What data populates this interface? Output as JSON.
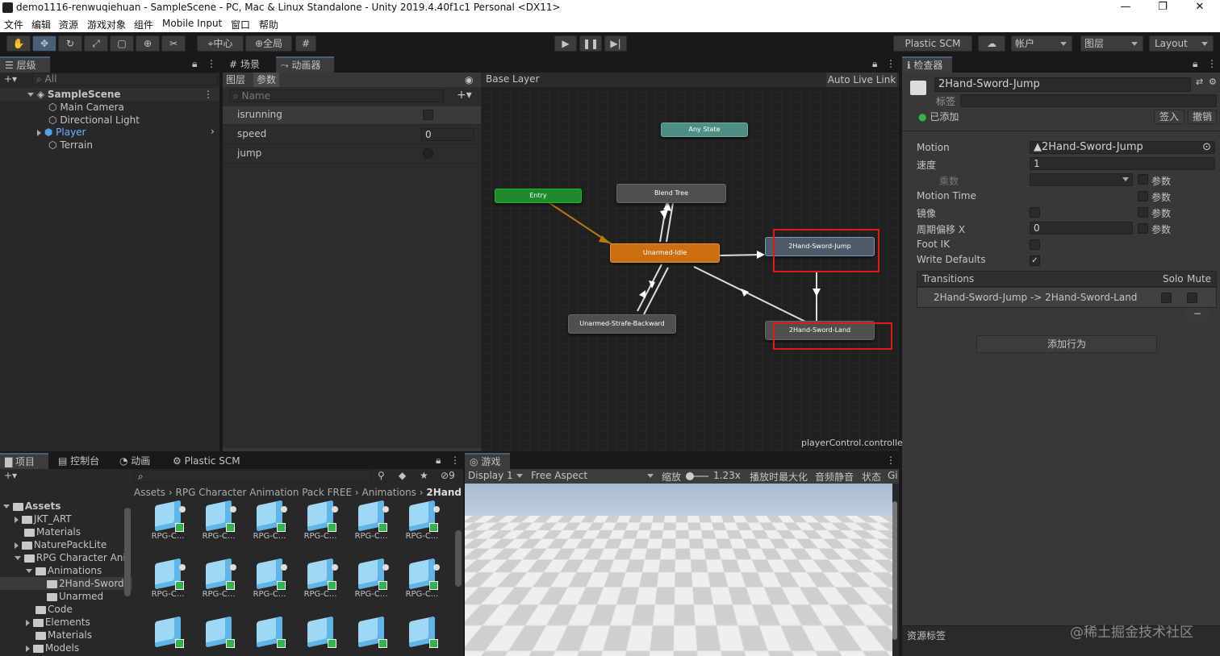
{
  "window": {
    "title": "demo1116-renwuqiehuan - SampleScene - PC, Mac & Linux Standalone - Unity 2019.4.40f1c1 Personal <DX11>",
    "min": "—",
    "max": "❐",
    "close": "✕"
  },
  "menu": [
    "文件",
    "编辑",
    "资源",
    "游戏对象",
    "组件",
    "Mobile Input",
    "窗口",
    "帮助"
  ],
  "toolbar": {
    "pivot": "中心",
    "global": "全局",
    "plastic": "Plastic SCM",
    "account": "帐户",
    "layers": "图层",
    "layout": "Layout"
  },
  "hierarchy": {
    "tab": "层级",
    "search": "All",
    "scene": "SampleScene",
    "items": [
      "Main Camera",
      "Directional Light",
      "Player",
      "Terrain"
    ]
  },
  "animator": {
    "tab_scene": "场景",
    "tab_animator": "动画器",
    "sub_layers": "图层",
    "sub_params": "参数",
    "search": "Name",
    "params": [
      {
        "name": "isrunning",
        "value": ""
      },
      {
        "name": "speed",
        "value": "0"
      },
      {
        "name": "jump",
        "value": ""
      }
    ],
    "layer": "Base Layer",
    "auto_live": "Auto Live Link",
    "controller": "playerControl.controller",
    "nodes": {
      "any": "Any State",
      "entry": "Entry",
      "blend": "Blend Tree",
      "idle": "Unarmed-Idle",
      "jump": "2Hand-Sword-Jump",
      "strafe": "Unarmed-Strafe-Backward",
      "land": "2Hand-Sword-Land"
    }
  },
  "inspector": {
    "tab": "检查器",
    "name": "2Hand-Sword-Jump",
    "tag": "标签",
    "added": "已添加",
    "btn_in": "签入",
    "btn_undo": "撤销",
    "motion_label": "Motion",
    "motion_value": "2Hand-Sword-Jump",
    "speed_label": "速度",
    "speed_value": "1",
    "mult_label": "乘数",
    "param": "参数",
    "motion_time": "Motion Time",
    "mirror": "镜像",
    "cycle_label": "周期偏移 X",
    "cycle_value": "0",
    "foot_ik": "Foot IK",
    "write_defaults": "Write Defaults",
    "transitions": "Transitions",
    "solo": "Solo",
    "mute": "Mute",
    "transition": "2Hand-Sword-Jump -> 2Hand-Sword-Land",
    "add_behaviour": "添加行为",
    "asset_labels": "资源标签",
    "check": "✓"
  },
  "project": {
    "tabs": [
      "项目",
      "控制台",
      "动画",
      "Plastic SCM"
    ],
    "count": "9",
    "breadcrumb": [
      "Assets",
      "RPG Character Animation Pack FREE",
      "Animations",
      "2Hand"
    ],
    "tree": [
      "Assets",
      "JKT_ART",
      "Materials",
      "NaturePackLite",
      "RPG Character Ani",
      "Animations",
      "2Hand-Sword",
      "Unarmed",
      "Code",
      "Elements",
      "Materials",
      "Models"
    ],
    "asset_label": "RPG-C..."
  },
  "game": {
    "tab": "游戏",
    "display": "Display 1",
    "aspect": "Free Aspect",
    "scale_label": "缩放",
    "scale_value": "1.23x",
    "maximize": "播放时最大化",
    "mute": "音频静音",
    "stats": "状态",
    "gizmos": "Gi"
  },
  "watermark": "@稀土掘金技术社区"
}
